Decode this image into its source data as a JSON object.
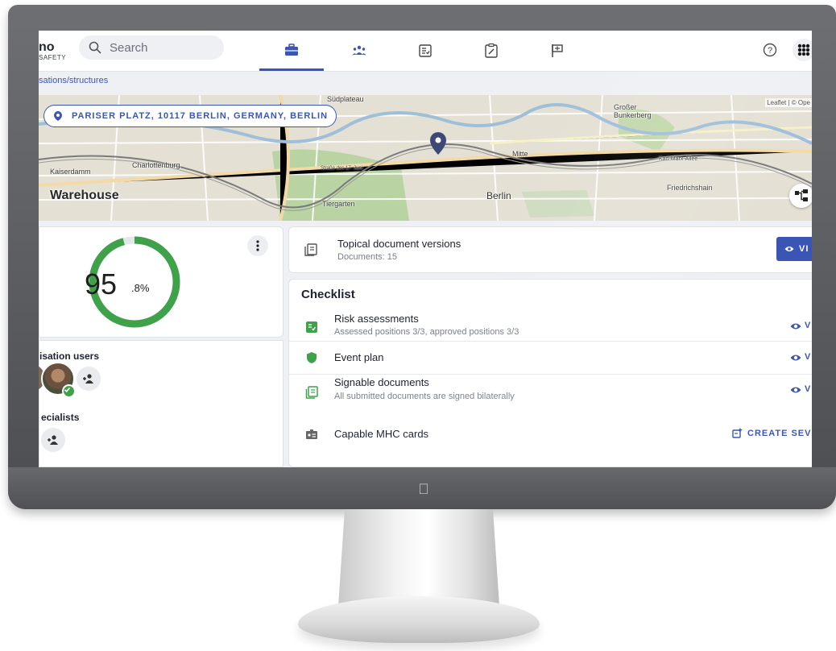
{
  "header": {
    "logo_main": "no",
    "logo_sub": "SAFETY",
    "search_placeholder": "Search",
    "tabs": [
      {
        "icon": "briefcase-icon",
        "active": true
      },
      {
        "icon": "people-icon",
        "active": false
      },
      {
        "icon": "checklist-icon",
        "active": false
      },
      {
        "icon": "clipboard-edit-icon",
        "active": false
      },
      {
        "icon": "flag-icon",
        "active": false
      }
    ],
    "help_icon": "help-circle-icon",
    "apps_icon": "apps-grid-icon"
  },
  "breadcrumb": "sations/structures",
  "map": {
    "address": "PARISER PLATZ, 10117 BERLIN, GERMANY, BERLIN",
    "location_name": "Warehouse",
    "attribution": "Leaflet | © Ope",
    "labels": {
      "sudplateau": "Südplateau",
      "grosser_bunkerberg": "Großer Bunkerberg",
      "charlottenburg": "Charlottenburg",
      "mitte": "Mitte",
      "tiergarten": "Tiergarten",
      "berlin": "Berlin",
      "friedrichshain": "Friedrichshain",
      "kaiserdamm": "Kaiserdamm",
      "karl_marx_allee": "Karl-Marx-Allee",
      "strasse_17_juni": "Straße des 17. Juni"
    }
  },
  "score": {
    "value_int": "95",
    "value_dec": ".8%",
    "percent": 95.8,
    "color": "#3fa24a"
  },
  "users": {
    "org_users_label": "isation users",
    "specialists_label": "ecialists"
  },
  "docs": {
    "title": "Topical document versions",
    "subtitle": "Documents: 15",
    "view_label": "VI"
  },
  "checklist": {
    "title": "Checklist",
    "rows": [
      {
        "title": "Risk assessments",
        "subtitle": "Assessed positions 3/3, approved positions 3/3",
        "action": "V"
      },
      {
        "title": "Event plan",
        "subtitle": "",
        "action": "V"
      },
      {
        "title": "Signable documents",
        "subtitle": "All submitted documents are signed bilaterally",
        "action": "V"
      },
      {
        "title": "Capable MHC cards",
        "subtitle": "",
        "action": "CREATE SEVE"
      }
    ]
  },
  "colors": {
    "accent": "#3b55b6",
    "success": "#3fa24a"
  }
}
